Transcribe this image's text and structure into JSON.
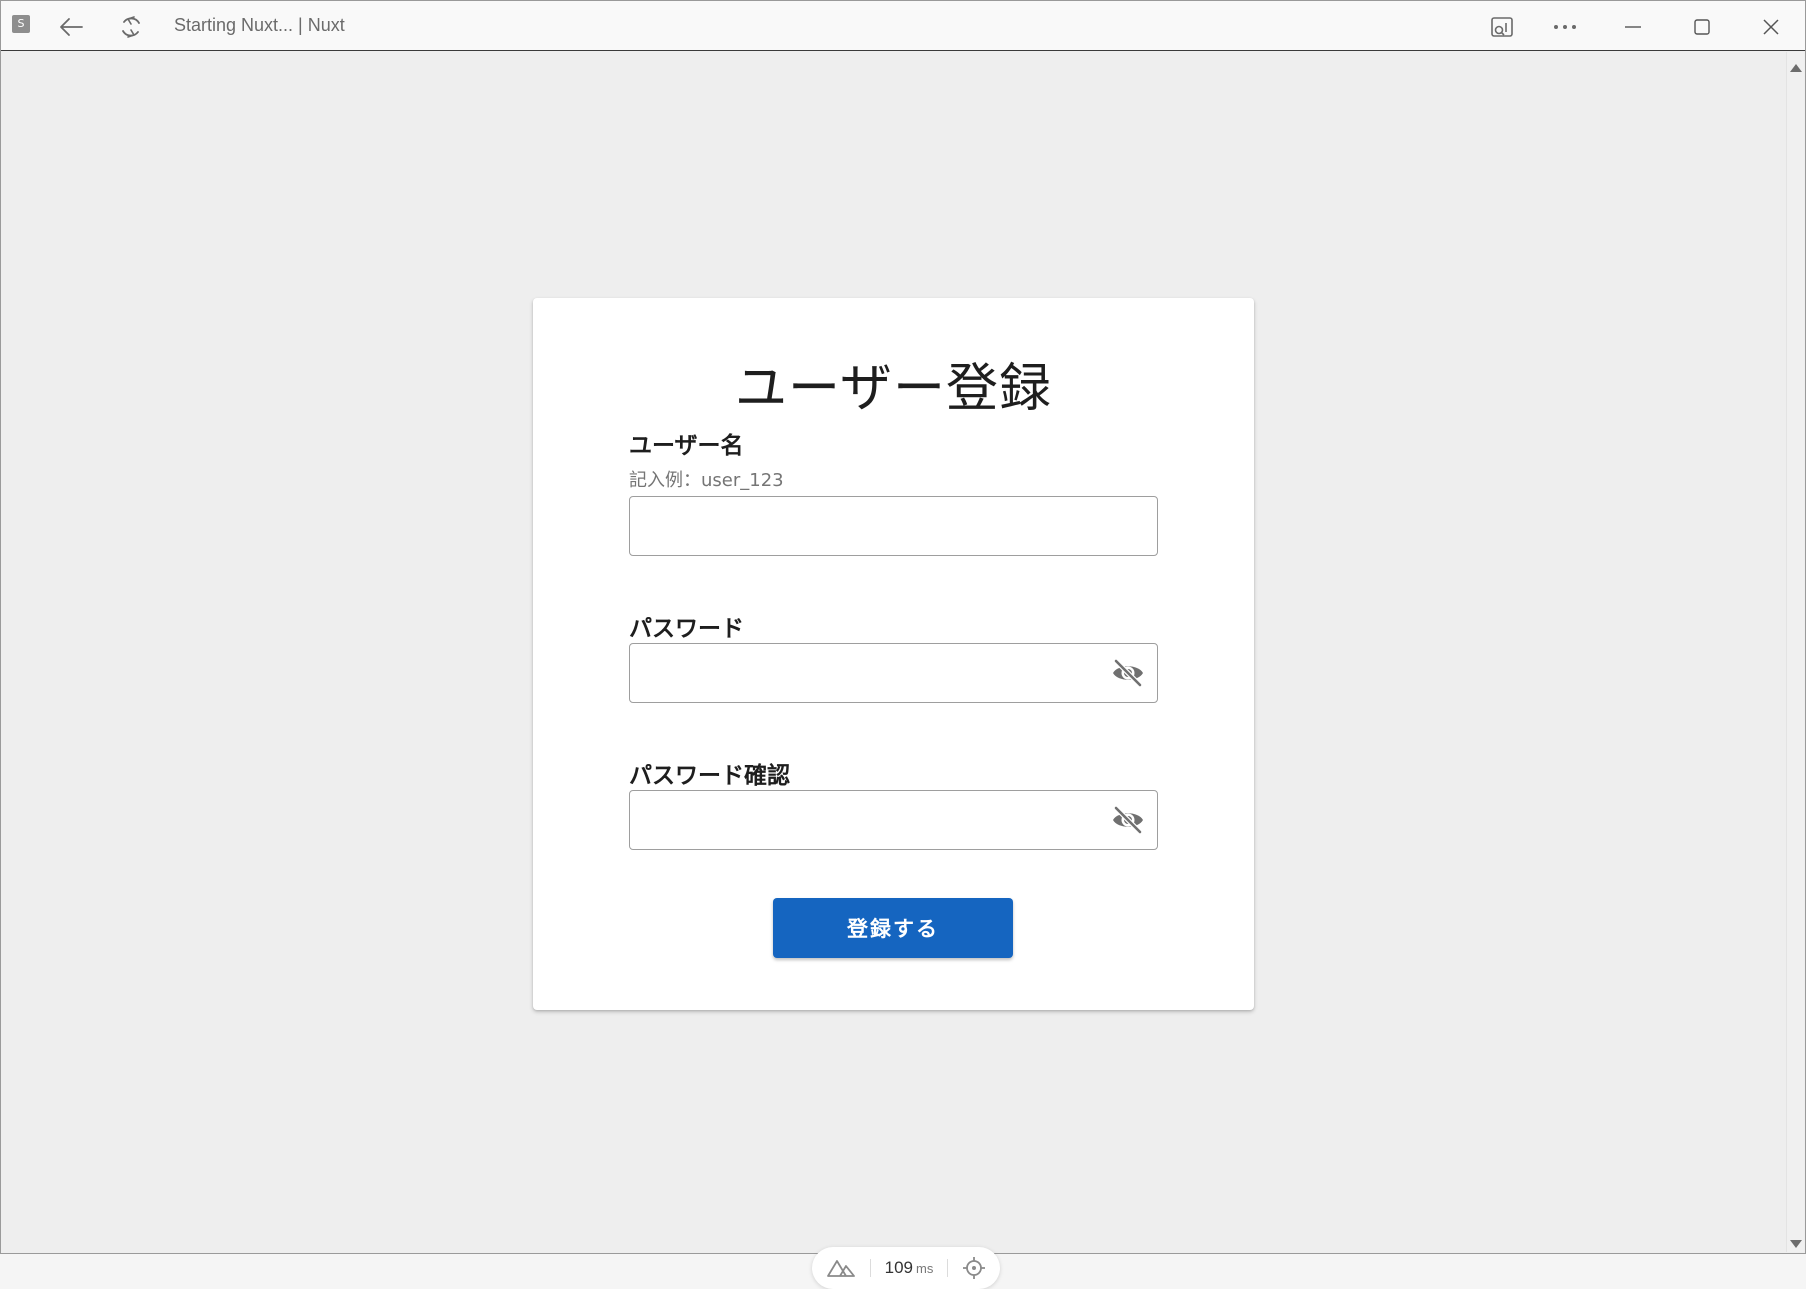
{
  "window": {
    "app_icon_letter": "S",
    "title": "Starting Nuxt... | Nuxt",
    "controls": {
      "back": "back-arrow-icon",
      "reload": "reload-icon",
      "cast": "screen-cast-icon",
      "more": "more-dots-icon",
      "minimize": "minimize-icon",
      "maximize": "maximize-icon",
      "close": "close-icon"
    }
  },
  "form": {
    "title": "ユーザー登録",
    "username": {
      "label": "ユーザー名",
      "hint": "記入例：user_123",
      "value": ""
    },
    "password": {
      "label": "パスワード",
      "value": "",
      "toggle_icon": "eye-off-icon"
    },
    "password_confirm": {
      "label": "パスワード確認",
      "value": "",
      "toggle_icon": "eye-off-icon"
    },
    "submit_label": "登録する"
  },
  "devtools": {
    "load_time": "109",
    "unit": "ms"
  },
  "colors": {
    "primary": "#1565c0",
    "background": "#eeeeee",
    "card": "#ffffff"
  }
}
